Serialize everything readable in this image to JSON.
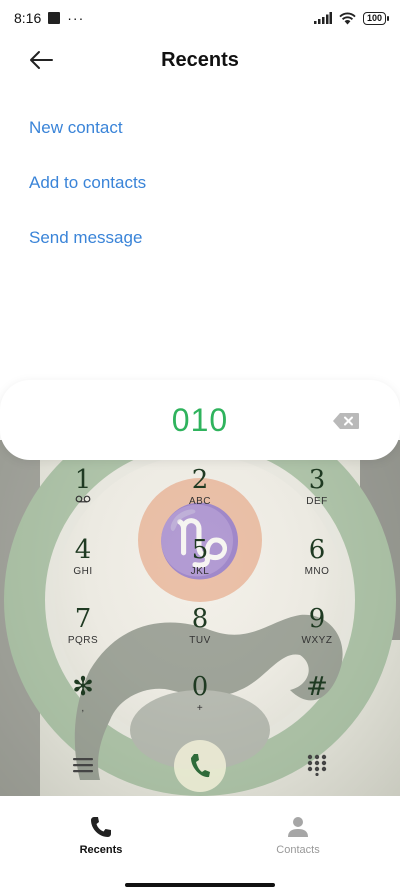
{
  "status_bar": {
    "time": "8:16",
    "dots": "···",
    "battery": "100"
  },
  "header": {
    "title": "Recents"
  },
  "actions": [
    {
      "label": "New contact"
    },
    {
      "label": "Add to contacts"
    },
    {
      "label": "Send message"
    }
  ],
  "dialer": {
    "number": "010",
    "keys": [
      {
        "digit": "1",
        "letters": ""
      },
      {
        "digit": "2",
        "letters": "ABC"
      },
      {
        "digit": "3",
        "letters": "DEF"
      },
      {
        "digit": "4",
        "letters": "GHI"
      },
      {
        "digit": "5",
        "letters": "JKL"
      },
      {
        "digit": "6",
        "letters": "MNO"
      },
      {
        "digit": "7",
        "letters": "PQRS"
      },
      {
        "digit": "8",
        "letters": "TUV"
      },
      {
        "digit": "9",
        "letters": "WXYZ"
      },
      {
        "digit": "✻",
        "letters": ","
      },
      {
        "digit": "0",
        "letters": "+"
      },
      {
        "digit": "#",
        "letters": ""
      }
    ]
  },
  "bottom_nav": [
    {
      "label": "Recents",
      "icon": "phone-icon",
      "active": true
    },
    {
      "label": "Contacts",
      "icon": "person-icon",
      "active": false
    }
  ],
  "colors": {
    "accent": "#3a84d8",
    "number": "#2fb35d",
    "call": "#2f6b3a"
  }
}
